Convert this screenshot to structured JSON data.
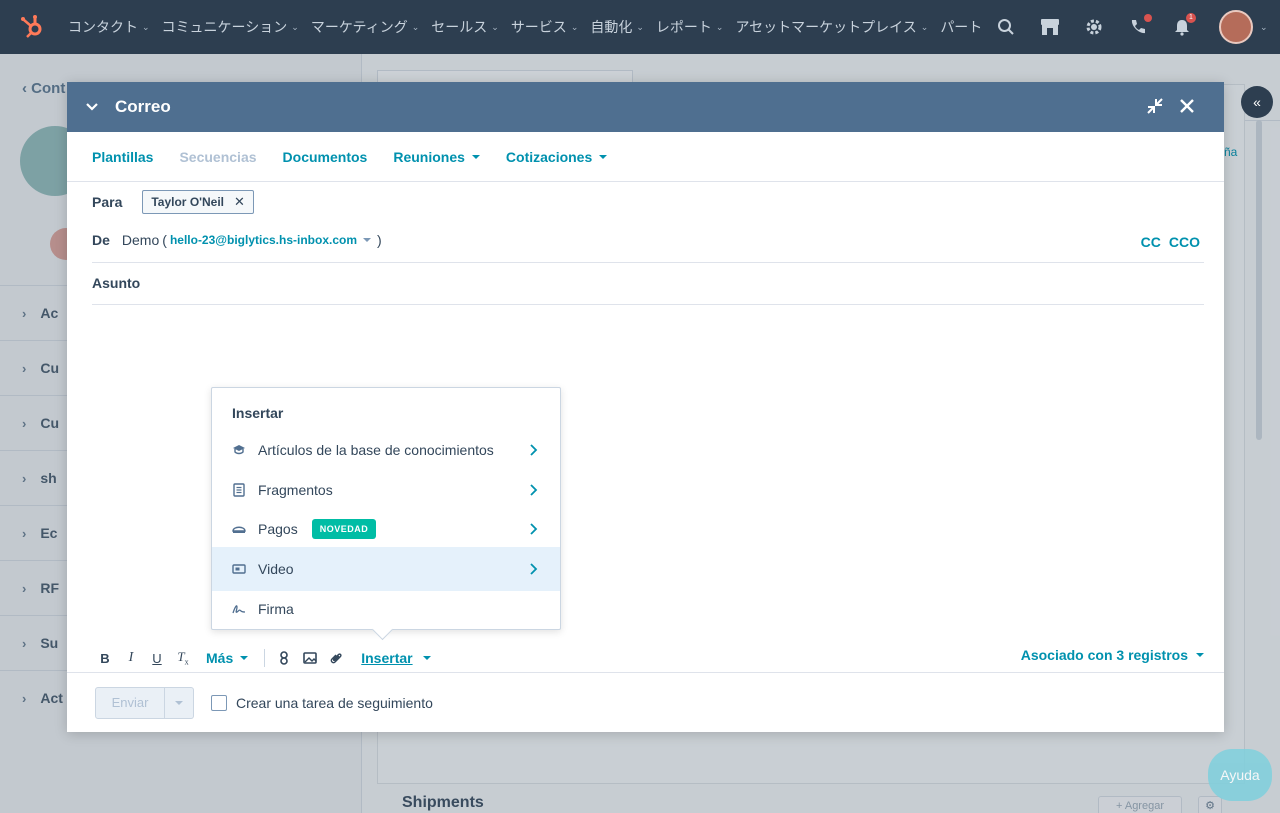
{
  "nav": {
    "items": [
      "コンタクト",
      "コミュニケーション",
      "マーケティング",
      "セールス",
      "サービス",
      "自動化",
      "レポート",
      "アセットマーケットプレイス",
      "パート"
    ],
    "notification_count": "1"
  },
  "background": {
    "back_link": "Cont",
    "rows": [
      "Ac",
      "Cu",
      "Cu",
      "sh",
      "Ec",
      "RF",
      "Su",
      "Act"
    ],
    "shipments": "Shipments",
    "add_button": "+ Agregar",
    "right_link": "ña",
    "help": "Ayuda"
  },
  "modal": {
    "title": "Correo",
    "tabs": [
      {
        "label": "Plantillas",
        "dropdown": false,
        "disabled": false
      },
      {
        "label": "Secuencias",
        "dropdown": false,
        "disabled": true
      },
      {
        "label": "Documentos",
        "dropdown": false,
        "disabled": false
      },
      {
        "label": "Reuniones",
        "dropdown": true,
        "disabled": false
      },
      {
        "label": "Cotizaciones",
        "dropdown": true,
        "disabled": false
      }
    ],
    "to_label": "Para",
    "recipient": "Taylor O'Neil",
    "from_label": "De",
    "from_name": "Demo",
    "from_email": "hello-23@biglytics.hs-inbox.com",
    "cc": "CC",
    "bcc": "CCO",
    "subject_label": "Asunto",
    "toolbar": {
      "more": "Más",
      "insert": "Insertar",
      "associated": "Asociado con 3 registros"
    },
    "send": "Enviar",
    "followup": "Crear una tarea de seguimiento"
  },
  "insert_menu": {
    "title": "Insertar",
    "items": [
      {
        "label": "Artículos de la base de conocimientos",
        "icon": "graduation-cap-icon",
        "submenu": true,
        "badge": ""
      },
      {
        "label": "Fragmentos",
        "icon": "document-icon",
        "submenu": true,
        "badge": ""
      },
      {
        "label": "Pagos",
        "icon": "payments-icon",
        "submenu": true,
        "badge": "NOVEDAD"
      },
      {
        "label": "Video",
        "icon": "video-icon",
        "submenu": true,
        "badge": "",
        "highlighted": true
      },
      {
        "label": "Firma",
        "icon": "signature-icon",
        "submenu": false,
        "badge": ""
      }
    ]
  },
  "colors": {
    "nav_bg": "#2d3e50",
    "header_bg": "#4f6f90",
    "link": "#0091ae",
    "badge_new": "#00bda5",
    "highlight": "#e5f1fb"
  }
}
